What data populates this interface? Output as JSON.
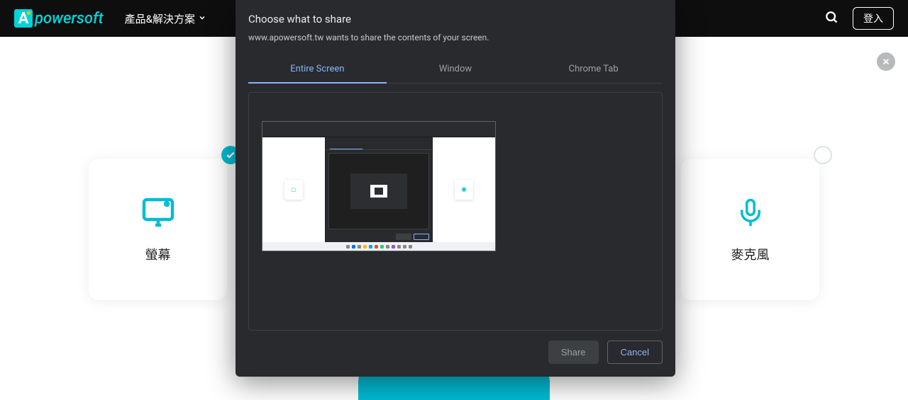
{
  "brand": {
    "letter": "A",
    "name": "powersoft"
  },
  "nav": {
    "products": "產品&解決方案",
    "login": "登入"
  },
  "page": {
    "cards": [
      {
        "label": "螢幕",
        "checked": true
      },
      {
        "label": "麥克風",
        "checked": false
      }
    ]
  },
  "modal": {
    "title": "Choose what to share",
    "desc": "www.apowersoft.tw wants to share the contents of your screen.",
    "tabs": [
      "Entire Screen",
      "Window",
      "Chrome Tab"
    ],
    "active_tab": 0,
    "actions": {
      "share": "Share",
      "cancel": "Cancel"
    }
  }
}
